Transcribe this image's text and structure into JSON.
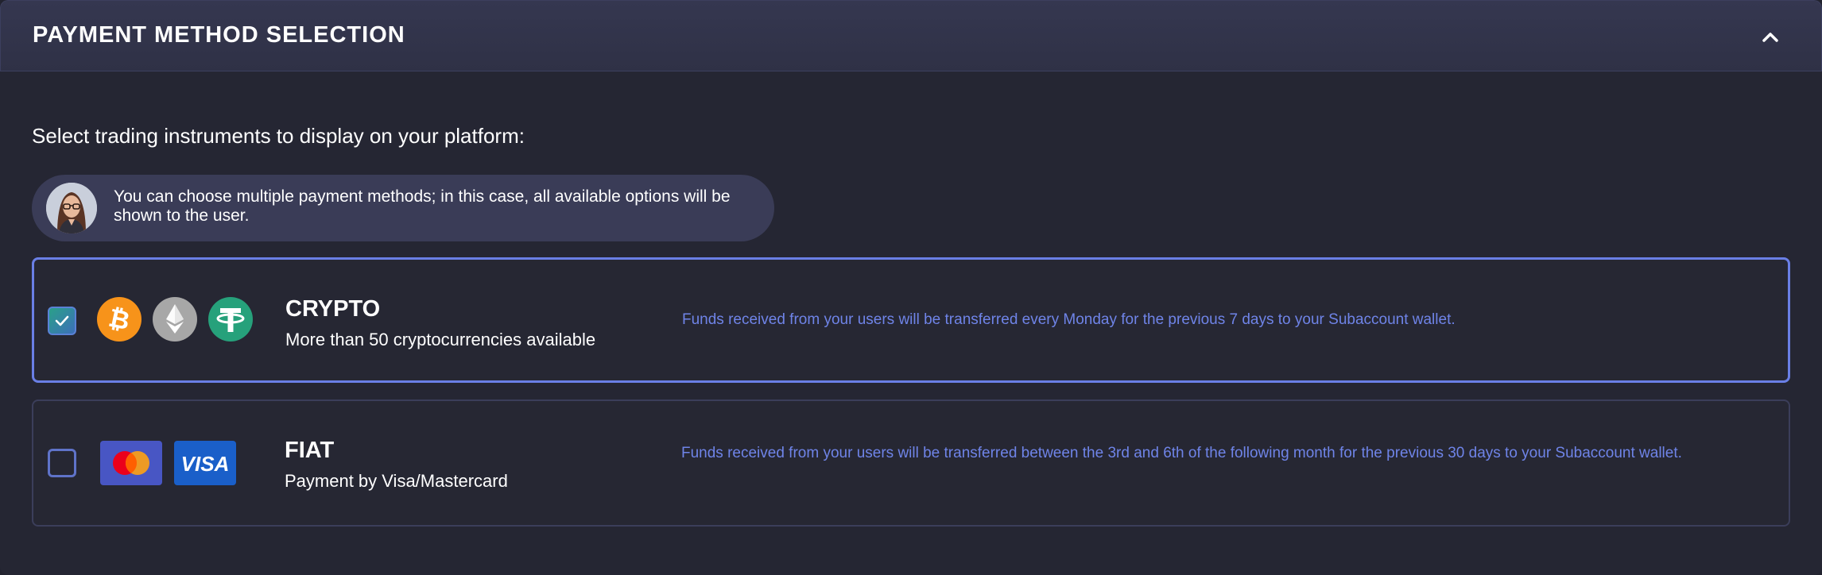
{
  "header": {
    "title": "PAYMENT METHOD SELECTION",
    "collapse_icon": "chevron-up-icon"
  },
  "subtitle": "Select trading instruments to display on your platform:",
  "hint": {
    "text": "You can choose multiple payment methods; in this case, all available options will be shown to the user."
  },
  "options": [
    {
      "id": "crypto",
      "title": "CRYPTO",
      "subtitle": "More than 50 cryptocurrencies available",
      "description": "Funds received from your users will be transferred every Monday for the previous 7 days to your Subaccount wallet.",
      "checked": true,
      "icons": [
        "bitcoin-icon",
        "ethereum-icon",
        "tether-icon"
      ]
    },
    {
      "id": "fiat",
      "title": "FIAT",
      "subtitle": "Payment by Visa/Mastercard",
      "description": "Funds received from your users will be transferred between the 3rd and 6th of the following month for the previous 30 days to your Subaccount wallet.",
      "checked": false,
      "icons": [
        "mastercard-icon",
        "visa-icon"
      ],
      "visa_text": "VISA"
    }
  ],
  "colors": {
    "accent": "#6a7fe6",
    "description_text": "#6f84e8",
    "bitcoin": "#f7931a",
    "ethereum": "#a7a7a7",
    "tether": "#26a17b",
    "visa": "#1a5fc9",
    "mastercard_bg": "#4856c4"
  }
}
